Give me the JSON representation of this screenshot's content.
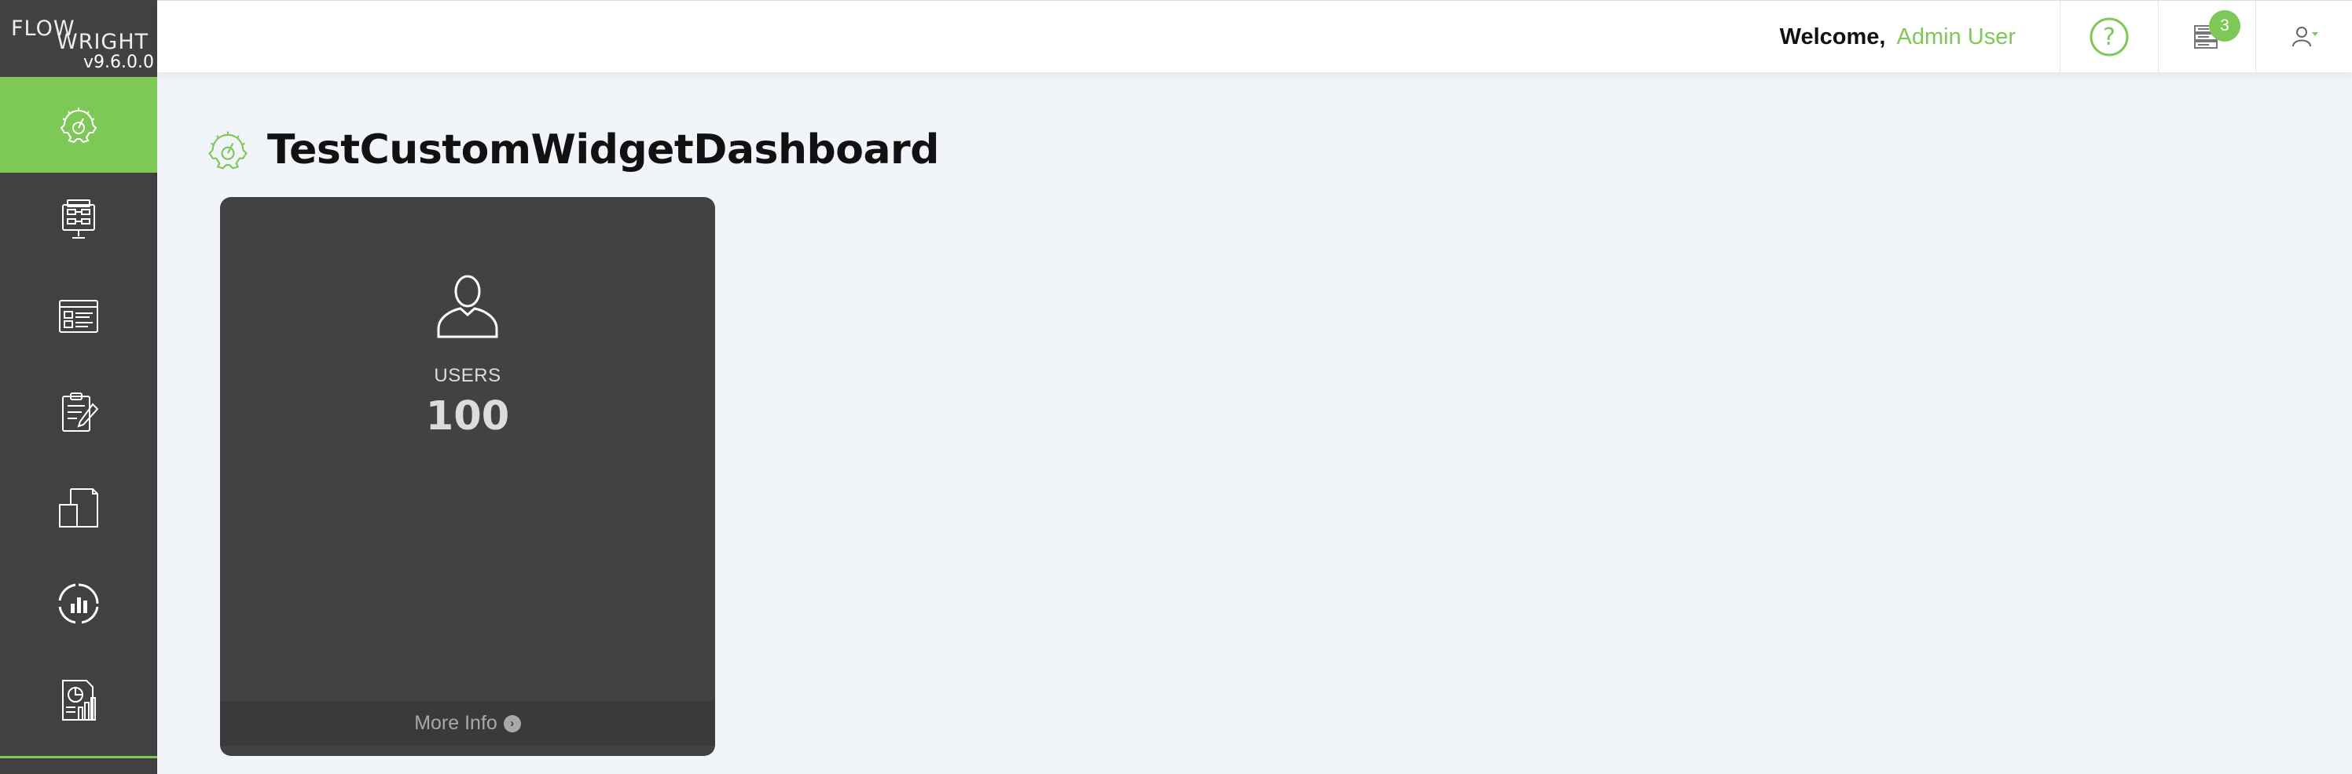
{
  "app": {
    "logo_line1": "FLOW",
    "logo_line2": "WRIGHT",
    "version": "v9.6.0.0"
  },
  "sidebar": {
    "items": [
      {
        "icon": "dashboard-gear-icon",
        "active": true
      },
      {
        "icon": "process-design-icon",
        "active": false
      },
      {
        "icon": "forms-icon",
        "active": false
      },
      {
        "icon": "tasks-edit-icon",
        "active": false
      },
      {
        "icon": "documents-icon",
        "active": false
      },
      {
        "icon": "analytics-icon",
        "active": false
      },
      {
        "icon": "reports-icon",
        "active": false
      }
    ]
  },
  "header": {
    "welcome_label": "Welcome,",
    "user_name": "Admin User",
    "help_icon": "help-icon",
    "notifications_icon": "notifications-icon",
    "notification_count": "3",
    "user_menu_icon": "user-menu-icon"
  },
  "page": {
    "title": "TestCustomWidgetDashboard"
  },
  "widget": {
    "icon": "user-icon",
    "label": "USERS",
    "value": "100",
    "footer_label": "More Info"
  },
  "colors": {
    "accent": "#7ec857",
    "sidebar": "#414141",
    "widget": "#424242",
    "background": "#f1f4f9"
  }
}
